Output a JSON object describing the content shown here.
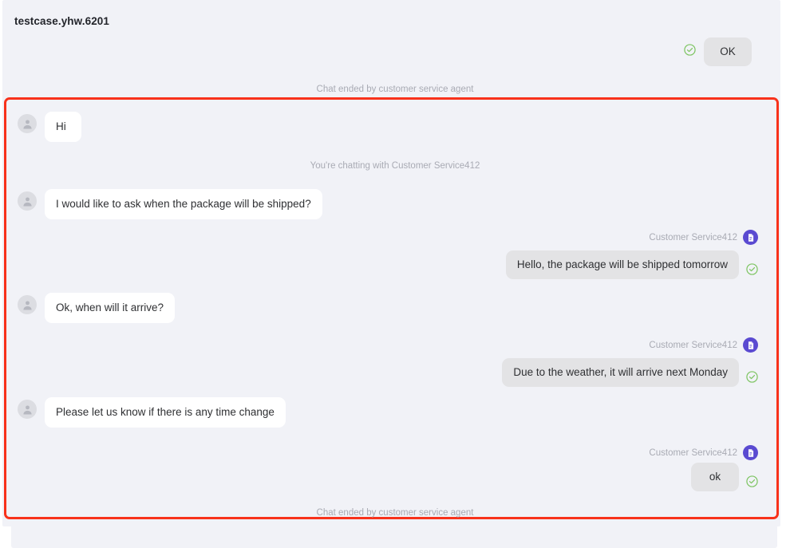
{
  "window": {
    "title": "testcase.yhw.6201",
    "background": "#f1f2f7",
    "highlight_color": "#f8321b"
  },
  "colors": {
    "agent_bubble": "#e3e3e5",
    "user_bubble": "#ffffff",
    "agent_avatar": "#5a4ad1",
    "user_avatar": "#dcdde2",
    "check_green": "#7dc461",
    "muted_text": "#a9abb4",
    "body_text": "#2f3033"
  },
  "top_message": {
    "text": "OK",
    "sender": "agent",
    "status_icon": "check-circle-icon"
  },
  "system_notes": {
    "top": "Chat ended by customer service agent",
    "middle": "You're chatting with Customer Service412",
    "bottom": "Chat ended by customer service agent"
  },
  "agent": {
    "name": "Customer Service412",
    "avatar_icon": "document-agent-icon"
  },
  "messages": [
    {
      "id": "m1",
      "sender": "user",
      "text": "Hi",
      "avatar_icon": "user-avatar-icon"
    },
    {
      "id": "m2",
      "sender": "user",
      "text": "I would like  to ask when the package will be shipped?",
      "avatar_icon": "user-avatar-icon"
    },
    {
      "id": "m3",
      "sender": "agent",
      "name": "Customer Service412",
      "text": "Hello, the package will be shipped tomorrow",
      "status_icon": "check-circle-icon"
    },
    {
      "id": "m4",
      "sender": "user",
      "text": "Ok, when will it arrive?",
      "avatar_icon": "user-avatar-icon"
    },
    {
      "id": "m5",
      "sender": "agent",
      "name": "Customer Service412",
      "text": "Due to the weather, it will arrive next Monday",
      "status_icon": "check-circle-icon"
    },
    {
      "id": "m6",
      "sender": "user",
      "text": "Please let us know if there is any time change",
      "avatar_icon": "user-avatar-icon"
    },
    {
      "id": "m7",
      "sender": "agent",
      "name": "Customer Service412",
      "text": "ok",
      "status_icon": "check-circle-icon"
    }
  ]
}
